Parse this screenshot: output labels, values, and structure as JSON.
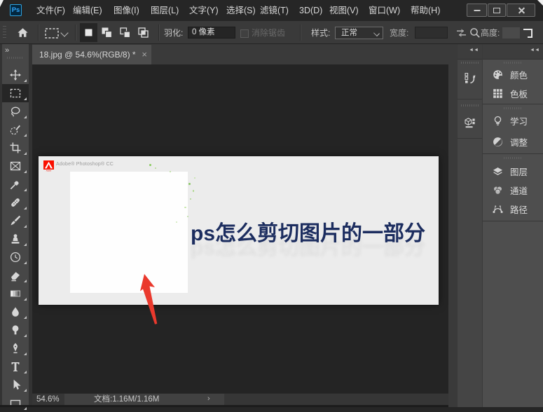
{
  "app": "Adobe Photoshop CC",
  "menubar": {
    "logo": "Ps",
    "items": [
      {
        "label": "文件(F)"
      },
      {
        "label": "编辑(E)"
      },
      {
        "label": "图像(I)"
      },
      {
        "label": "图层(L)"
      },
      {
        "label": "文字(Y)"
      },
      {
        "label": "选择(S)"
      },
      {
        "label": "滤镜(T)"
      },
      {
        "label": "3D(D)"
      },
      {
        "label": "视图(V)"
      },
      {
        "label": "窗口(W)"
      },
      {
        "label": "帮助(H)"
      }
    ],
    "window_controls": [
      "minimize",
      "maximize",
      "close"
    ]
  },
  "options_bar": {
    "tool_icon": "rectangular-marquee",
    "mode_icons": [
      "new-selection",
      "add-to-selection",
      "subtract-from-selection",
      "intersect-selection"
    ],
    "feather": {
      "label": "羽化:",
      "value": "0 像素"
    },
    "antialias": {
      "label": "消除锯齿",
      "checked": false,
      "disabled": true
    },
    "style": {
      "label": "样式:",
      "value": "正常"
    },
    "width": {
      "label": "宽度:",
      "value": ""
    },
    "height": {
      "label": "高度:",
      "value": ""
    }
  },
  "toolbar": {
    "expand_glyph": "»",
    "selected_tool": "rectangular-marquee",
    "tools": [
      "move",
      "rectangular-marquee",
      "lasso",
      "quick-selection",
      "crop",
      "frame",
      "eyedropper",
      "spot-healing-brush",
      "brush",
      "clone-stamp",
      "history-brush",
      "eraser",
      "gradient",
      "blur",
      "dodge",
      "pen",
      "type",
      "path-selection",
      "rectangle-shape"
    ]
  },
  "document_tab": {
    "title": "18.jpg @ 54.6%(RGB/8) *",
    "close_glyph": "×"
  },
  "canvas": {
    "brand_text": "Adobe® Photoshop® CC",
    "headline": "ps怎么剪切图片的一部分",
    "headline_color": "#1c2d5f",
    "arrow_color": "#ea392d",
    "image_bg": "#ececec"
  },
  "dock": {
    "collapse_glyph": "◄◄",
    "icon_buttons": [
      {
        "name": "history-panel"
      },
      {
        "name": "3d-panel"
      }
    ],
    "panel_tabs": [
      {
        "label": "颜色",
        "icon": "color-palette"
      },
      {
        "label": "色板",
        "icon": "swatches-grid"
      },
      {
        "label": "学习",
        "icon": "learn-bulb"
      },
      {
        "label": "调整",
        "icon": "adjustments-circle"
      },
      {
        "label": "图层",
        "icon": "layers"
      },
      {
        "label": "通道",
        "icon": "channels"
      },
      {
        "label": "路径",
        "icon": "paths"
      }
    ]
  },
  "status_bar": {
    "zoom": "54.6%",
    "document_info": "文档:1.16M/1.16M",
    "expander_glyph": "›"
  }
}
